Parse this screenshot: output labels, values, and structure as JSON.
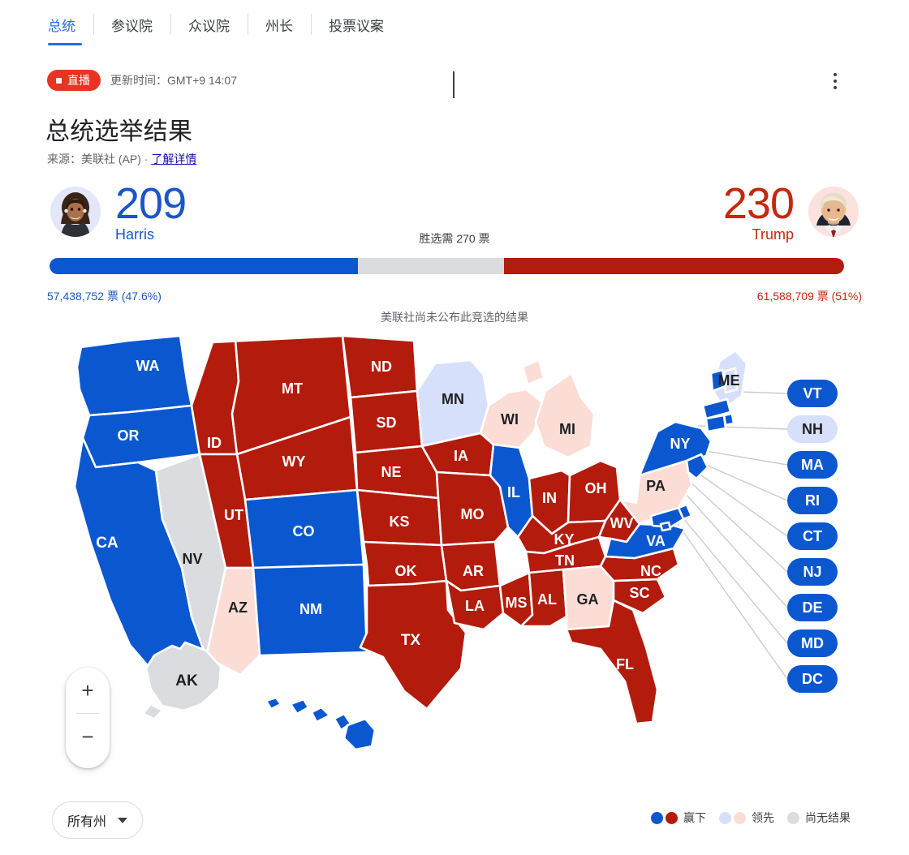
{
  "tabs": [
    {
      "label": "总统",
      "active": true
    },
    {
      "label": "参议院",
      "active": false
    },
    {
      "label": "众议院",
      "active": false
    },
    {
      "label": "州长",
      "active": false
    },
    {
      "label": "投票议案",
      "active": false
    }
  ],
  "status": {
    "live_label": "直播",
    "updated_text": "更新时间：GMT+9 14:07",
    "menu_icon": "overflow-menu-icon"
  },
  "header": {
    "title": "总统选举结果",
    "source_prefix": "来源：",
    "source_name": "美联社 (AP)",
    "separator": " · ",
    "learn_more": "了解详情"
  },
  "race": {
    "needed_label": "胜选需 270 票",
    "not_called": "美联社尚未公布此竞选的结果",
    "threshold": 270,
    "total_electoral": 538,
    "left": {
      "name": "Harris",
      "electoral": "209",
      "votes_text": "57,438,752 票 (47.6%)",
      "color": "#0b57d0",
      "text_color": "#1a56c4"
    },
    "right": {
      "name": "Trump",
      "electoral": "230",
      "votes_text": "61,588,709 票 (51%)",
      "color": "#b31b0c",
      "text_color": "#c5280c"
    }
  },
  "colors": {
    "won_dem": "#0b57d0",
    "won_rep": "#b31b0c",
    "lead_dem": "#d7e0fb",
    "lead_rep": "#fbddd6",
    "no_result": "#dadce0",
    "stroke": "#ffffff",
    "accent": "#1a73e8"
  },
  "map": {
    "zoom_in_label": "+",
    "zoom_out_label": "−",
    "states": [
      {
        "code": "WA",
        "status": "won_dem"
      },
      {
        "code": "OR",
        "status": "won_dem"
      },
      {
        "code": "CA",
        "status": "won_dem"
      },
      {
        "code": "NV",
        "status": "no_result"
      },
      {
        "code": "ID",
        "status": "won_rep"
      },
      {
        "code": "MT",
        "status": "won_rep"
      },
      {
        "code": "WY",
        "status": "won_rep"
      },
      {
        "code": "UT",
        "status": "won_rep"
      },
      {
        "code": "AZ",
        "status": "lead_rep"
      },
      {
        "code": "CO",
        "status": "won_dem"
      },
      {
        "code": "NM",
        "status": "won_dem"
      },
      {
        "code": "ND",
        "status": "won_rep"
      },
      {
        "code": "SD",
        "status": "won_rep"
      },
      {
        "code": "NE",
        "status": "won_rep"
      },
      {
        "code": "KS",
        "status": "won_rep"
      },
      {
        "code": "OK",
        "status": "won_rep"
      },
      {
        "code": "TX",
        "status": "won_rep"
      },
      {
        "code": "MN",
        "status": "lead_dem"
      },
      {
        "code": "IA",
        "status": "won_rep"
      },
      {
        "code": "MO",
        "status": "won_rep"
      },
      {
        "code": "AR",
        "status": "won_rep"
      },
      {
        "code": "LA",
        "status": "won_rep"
      },
      {
        "code": "WI",
        "status": "lead_rep"
      },
      {
        "code": "IL",
        "status": "won_dem"
      },
      {
        "code": "MI",
        "status": "lead_rep"
      },
      {
        "code": "IN",
        "status": "won_rep"
      },
      {
        "code": "OH",
        "status": "won_rep"
      },
      {
        "code": "KY",
        "status": "won_rep"
      },
      {
        "code": "TN",
        "status": "won_rep"
      },
      {
        "code": "MS",
        "status": "won_rep"
      },
      {
        "code": "AL",
        "status": "won_rep"
      },
      {
        "code": "GA",
        "status": "lead_rep"
      },
      {
        "code": "FL",
        "status": "won_rep"
      },
      {
        "code": "SC",
        "status": "won_rep"
      },
      {
        "code": "NC",
        "status": "won_rep"
      },
      {
        "code": "WV",
        "status": "won_rep"
      },
      {
        "code": "VA",
        "status": "won_dem"
      },
      {
        "code": "PA",
        "status": "lead_rep"
      },
      {
        "code": "NY",
        "status": "won_dem"
      },
      {
        "code": "ME",
        "status": "lead_dem"
      },
      {
        "code": "AK",
        "status": "no_result"
      },
      {
        "code": "HI",
        "status": "won_dem"
      }
    ],
    "callouts": [
      {
        "code": "VT",
        "status": "won_dem"
      },
      {
        "code": "NH",
        "status": "lead_dem"
      },
      {
        "code": "MA",
        "status": "won_dem"
      },
      {
        "code": "RI",
        "status": "won_dem"
      },
      {
        "code": "CT",
        "status": "won_dem"
      },
      {
        "code": "NJ",
        "status": "won_dem"
      },
      {
        "code": "DE",
        "status": "won_dem"
      },
      {
        "code": "MD",
        "status": "won_dem"
      },
      {
        "code": "DC",
        "status": "won_dem"
      }
    ]
  },
  "footer": {
    "state_filter": "所有州",
    "legend": [
      {
        "label": "赢下",
        "swatches": [
          "#0b57d0",
          "#b31b0c"
        ]
      },
      {
        "label": "领先",
        "swatches": [
          "#d7e0fb",
          "#fbddd6"
        ]
      },
      {
        "label": "尚无结果",
        "swatches": [
          "#dadce0"
        ]
      }
    ]
  }
}
